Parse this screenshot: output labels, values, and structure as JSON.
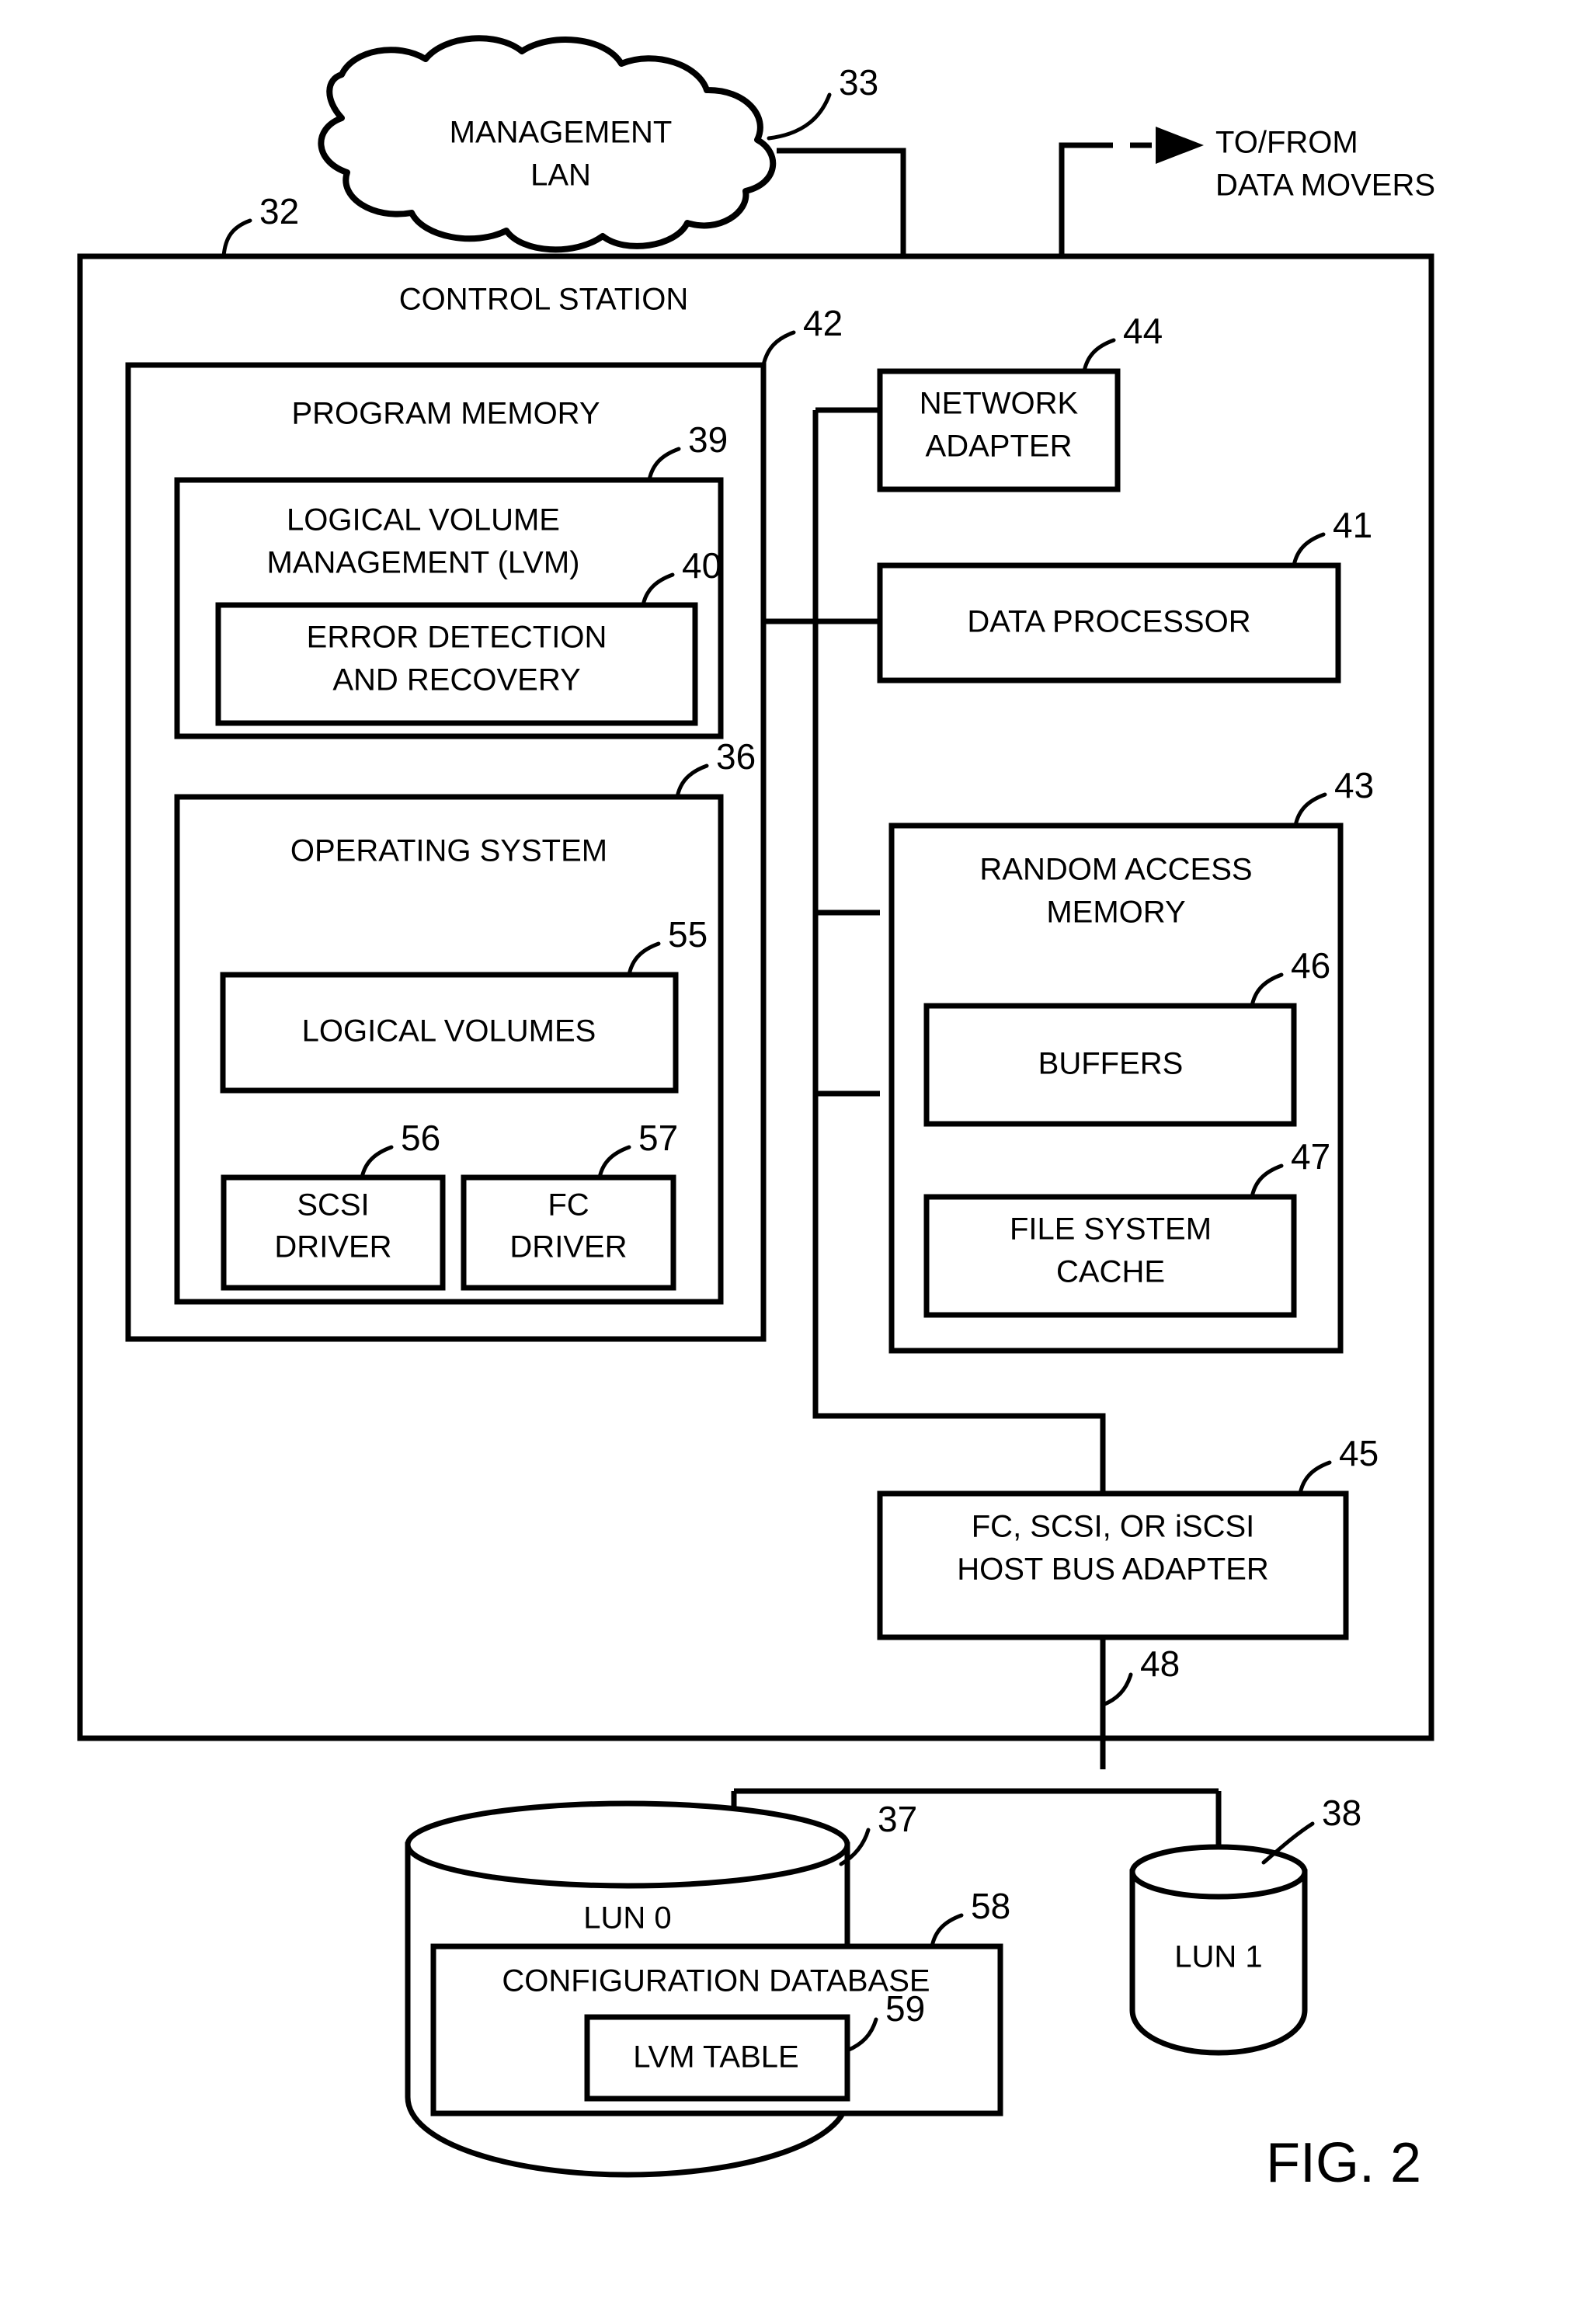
{
  "figure": {
    "label": "FIG. 2",
    "title": "CONTROL STATION"
  },
  "nodes": {
    "management_lan": {
      "line1": "MANAGEMENT",
      "line2": "LAN",
      "ref": "33"
    },
    "to_from_data_movers": {
      "line1": "TO/FROM",
      "line2": "DATA MOVERS"
    },
    "control_station": {
      "label": "CONTROL STATION",
      "ref": "32"
    },
    "program_memory": {
      "label": "PROGRAM MEMORY",
      "ref": "42"
    },
    "lvm": {
      "line1": "LOGICAL VOLUME",
      "line2": "MANAGEMENT (LVM)",
      "ref": "39"
    },
    "error_detection": {
      "line1": "ERROR DETECTION",
      "line2": "AND RECOVERY",
      "ref": "40"
    },
    "operating_system": {
      "label": "OPERATING SYSTEM",
      "ref": "36"
    },
    "logical_volumes": {
      "label": "LOGICAL VOLUMES",
      "ref": "55"
    },
    "scsi_driver": {
      "line1": "SCSI",
      "line2": "DRIVER",
      "ref": "56"
    },
    "fc_driver": {
      "line1": "FC",
      "line2": "DRIVER",
      "ref": "57"
    },
    "network_adapter": {
      "line1": "NETWORK",
      "line2": "ADAPTER",
      "ref": "44"
    },
    "data_processor": {
      "label": "DATA PROCESSOR",
      "ref": "41"
    },
    "random_access_memory": {
      "line1": "RANDOM ACCESS",
      "line2": "MEMORY",
      "ref": "43"
    },
    "buffers": {
      "label": "BUFFERS",
      "ref": "46"
    },
    "file_system_cache": {
      "line1": "FILE SYSTEM",
      "line2": "CACHE",
      "ref": "47"
    },
    "host_bus_adapter": {
      "line1": "FC, SCSI, OR iSCSI",
      "line2": "HOST BUS ADAPTER",
      "ref": "45"
    },
    "storage_bus": {
      "ref": "48"
    },
    "lun0": {
      "label": "LUN 0",
      "ref": "37"
    },
    "lun1": {
      "label": "LUN 1",
      "ref": "38"
    },
    "configuration_database": {
      "label": "CONFIGURATION DATABASE",
      "ref": "58"
    },
    "lvm_table": {
      "label": "LVM TABLE",
      "ref": "59"
    }
  },
  "colors": {
    "ink": "#000000",
    "paper": "#ffffff"
  }
}
